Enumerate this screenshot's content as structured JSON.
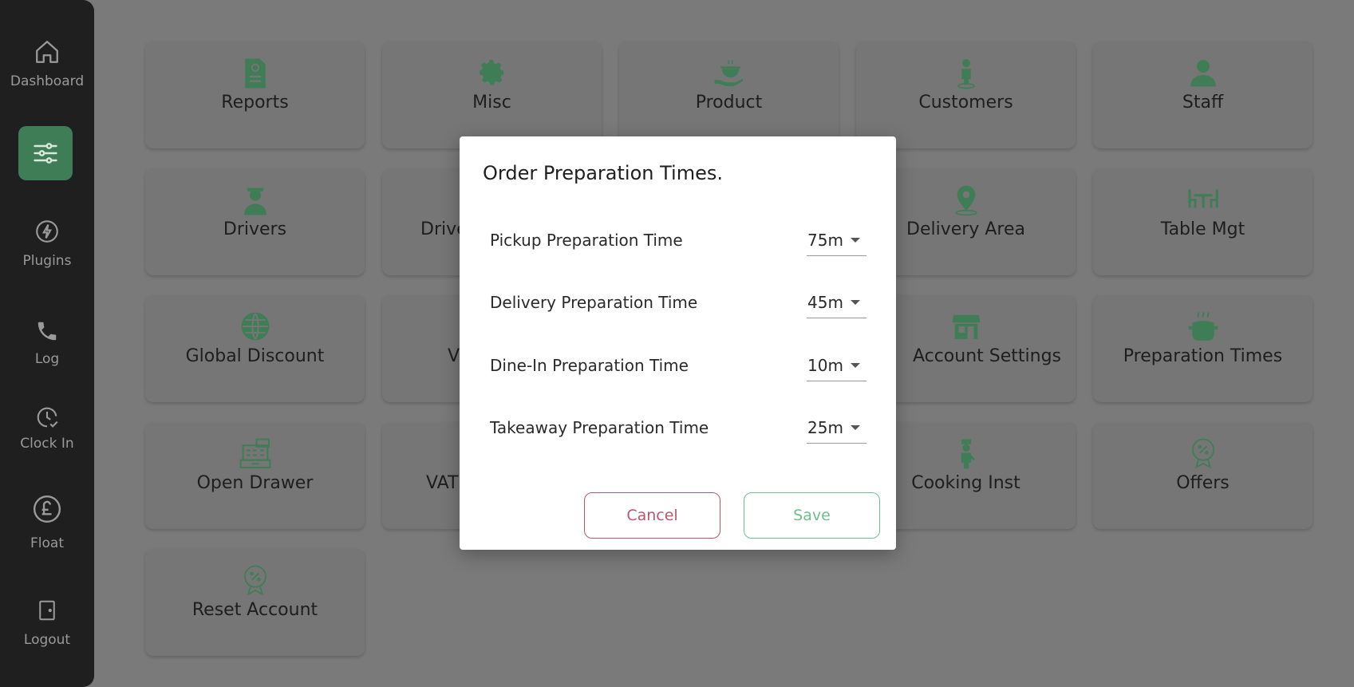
{
  "colors": {
    "accent": "#3e7d55",
    "sidebar_bg": "#1f1f1f",
    "overlay_bg": "#7a7a7a",
    "cancel": "#b8576c",
    "save": "#6fbf8a"
  },
  "sidebar": {
    "items": [
      {
        "label": "Dashboard",
        "icon": "home-icon"
      },
      {
        "label": "",
        "icon": "sliders-icon",
        "active": true
      },
      {
        "label": "Plugins",
        "icon": "plugin-bolt-icon"
      },
      {
        "label": "Log",
        "icon": "phone-icon"
      },
      {
        "label": "Clock In",
        "icon": "clock-check-icon"
      },
      {
        "label": "Float",
        "icon": "pound-icon"
      },
      {
        "label": "Logout",
        "icon": "door-icon"
      }
    ]
  },
  "grid": {
    "tiles": [
      {
        "label": "Reports",
        "icon": "report-icon"
      },
      {
        "label": "Misc",
        "icon": "gear-icon"
      },
      {
        "label": "Product",
        "icon": "food-hand-icon"
      },
      {
        "label": "Customers",
        "icon": "customer-icon"
      },
      {
        "label": "Staff",
        "icon": "person-icon"
      },
      {
        "label": "Drivers",
        "icon": "driver-icon"
      },
      {
        "label": "Drive",
        "icon": ""
      },
      {
        "label": "",
        "icon": ""
      },
      {
        "label": "Delivery Area",
        "icon": "map-pin-icon"
      },
      {
        "label": "Table Mgt",
        "icon": "table-icon"
      },
      {
        "label": "Global Discount",
        "icon": "globe-icon"
      },
      {
        "label": "V",
        "icon": ""
      },
      {
        "label": "",
        "icon": ""
      },
      {
        "label": "Account Settings",
        "icon": "store-icon"
      },
      {
        "label": "Preparation Times",
        "icon": "cooking-pot-icon"
      },
      {
        "label": "Open Drawer",
        "icon": "cash-register-icon"
      },
      {
        "label": "VAT",
        "icon": ""
      },
      {
        "label": "",
        "icon": ""
      },
      {
        "label": "Cooking Inst",
        "icon": "chef-icon"
      },
      {
        "label": "Offers",
        "icon": "badge-percent-icon"
      },
      {
        "label": "Reset Account",
        "icon": "badge-percent-icon"
      }
    ]
  },
  "modal": {
    "title": "Order Preparation Times.",
    "rows": [
      {
        "label": "Pickup Preparation Time",
        "value": "75m"
      },
      {
        "label": "Delivery Preparation Time",
        "value": "45m"
      },
      {
        "label": "Dine-In Preparation Time",
        "value": "10m"
      },
      {
        "label": "Takeaway Preparation Time",
        "value": "25m"
      }
    ],
    "cancel_label": "Cancel",
    "save_label": "Save"
  }
}
